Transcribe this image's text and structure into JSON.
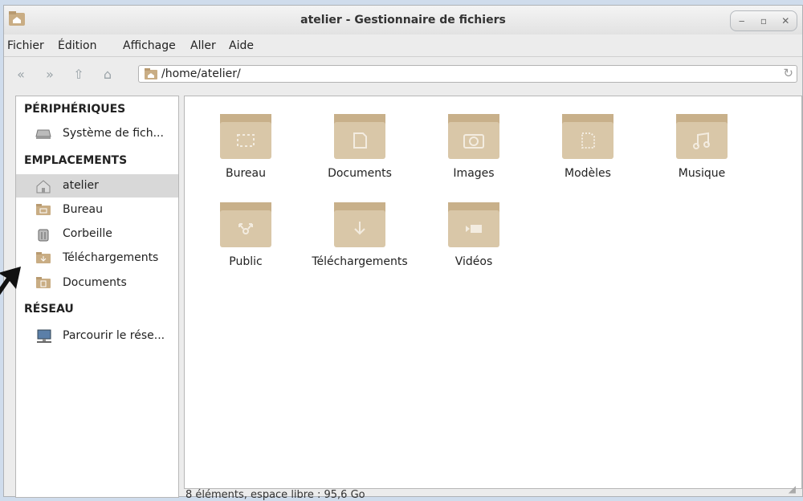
{
  "window": {
    "title": "atelier - Gestionnaire de fichiers"
  },
  "menu": [
    "Fichier",
    "Édition",
    "Affichage",
    "Aller",
    "Aide"
  ],
  "location": {
    "path": "/home/atelier/"
  },
  "sidebar": {
    "sections": [
      {
        "header": "PÉRIPHÉRIQUES",
        "items": [
          {
            "label": "Système de fich...",
            "icon": "drive-icon"
          }
        ]
      },
      {
        "header": "EMPLACEMENTS",
        "items": [
          {
            "label": "atelier",
            "icon": "home-icon",
            "selected": true
          },
          {
            "label": "Bureau",
            "icon": "desktop-folder-icon"
          },
          {
            "label": "Corbeille",
            "icon": "trash-icon"
          },
          {
            "label": "Téléchargements",
            "icon": "download-folder-icon"
          },
          {
            "label": "Documents",
            "icon": "documents-folder-icon"
          }
        ]
      },
      {
        "header": "RÉSEAU",
        "items": [
          {
            "label": "Parcourir le rése...",
            "icon": "network-icon"
          }
        ]
      }
    ]
  },
  "files": [
    {
      "label": "Bureau",
      "icon": "desktop"
    },
    {
      "label": "Documents",
      "icon": "documents"
    },
    {
      "label": "Images",
      "icon": "camera"
    },
    {
      "label": "Modèles",
      "icon": "templates"
    },
    {
      "label": "Musique",
      "icon": "music"
    },
    {
      "label": "Public",
      "icon": "share"
    },
    {
      "label": "Téléchargements",
      "icon": "download"
    },
    {
      "label": "Vidéos",
      "icon": "video"
    }
  ],
  "status": "8 éléments, espace libre : 95,6 Go",
  "colors": {
    "folder": "#d9c7a8",
    "folder_dark": "#c8b08a",
    "selection": "#d8d8d8"
  }
}
